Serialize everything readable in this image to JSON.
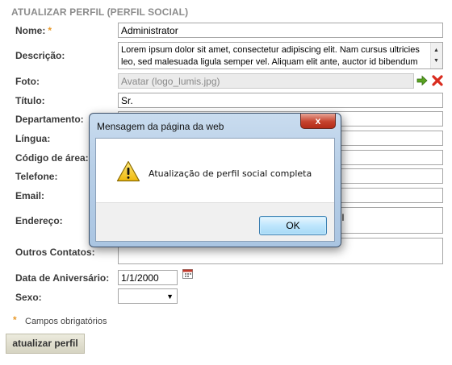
{
  "form": {
    "title": "ATUALIZAR PERFIL (PERFIL SOCIAL)",
    "required_marker": "*",
    "fields": {
      "nome": {
        "label": "Nome:",
        "value": "Administrator"
      },
      "descricao": {
        "label": "Descrição:",
        "value": "Lorem ipsum dolor sit amet, consectetur adipiscing elit. Nam cursus ultricies leo, sed malesuada ligula semper vel. Aliquam elit ante, auctor id bibendum ac,"
      },
      "foto": {
        "label": "Foto:",
        "value": "Avatar (logo_lumis.jpg)"
      },
      "titulo": {
        "label": "Título:",
        "value": "Sr."
      },
      "departamento": {
        "label": "Departamento:",
        "value": ""
      },
      "lingua": {
        "label": "Língua:",
        "value": ""
      },
      "codigo_area": {
        "label": "Código de área:",
        "value": ""
      },
      "telefone": {
        "label": "Telefone:",
        "value": ""
      },
      "email": {
        "label": "Email:",
        "value": ""
      },
      "endereco": {
        "label": "Endereço:",
        "value": "sil"
      },
      "outros_contatos": {
        "label": "Outros Contatos:",
        "value": ""
      },
      "aniversario": {
        "label": "Data de Aniversário:",
        "value": "1/1/2000"
      },
      "sexo": {
        "label": "Sexo:",
        "value": ""
      }
    },
    "required_note": "Campos obrigatórios",
    "submit_label": "atualizar perfil"
  },
  "dialog": {
    "title": "Mensagem da página da web",
    "message": "Atualização de perfil social completa",
    "ok_label": "OK",
    "close_label": "x"
  },
  "icons": {
    "foto_confirm": "arrow-right-icon",
    "foto_remove": "red-x-icon",
    "calendar": "calendar-icon",
    "warning": "warning-icon"
  }
}
